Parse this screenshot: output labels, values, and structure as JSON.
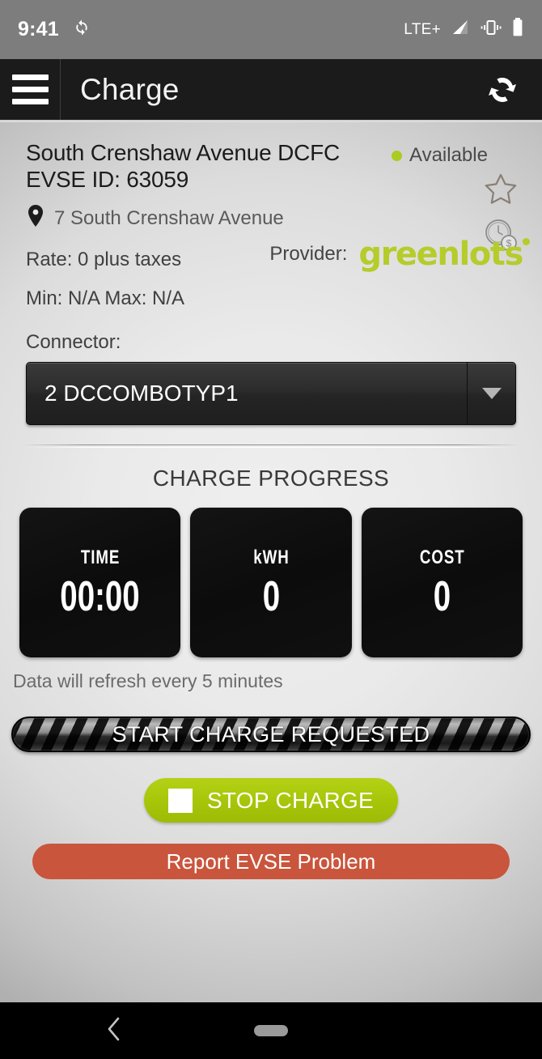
{
  "statusbar": {
    "time": "9:41",
    "sync_icon": "sync-icon",
    "network_label": "LTE+",
    "signal_icon": "signal-bars-icon",
    "vibrate_icon": "vibrate-icon",
    "battery_icon": "battery-icon"
  },
  "appbar": {
    "menu_icon": "hamburger-menu-icon",
    "title": "Charge",
    "refresh_icon": "refresh-sync-icon"
  },
  "station": {
    "title": "South Crenshaw Avenue DCFC EVSE ID: 63059",
    "status_label": "Available",
    "status_color": "#aacc22",
    "address": "7 South Crenshaw Avenue",
    "address_icon": "location-pin-icon",
    "rate_line": "Rate: 0 plus taxes",
    "minmax_line": "Min: N/A Max: N/A",
    "favorite_icon": "star-outline-icon",
    "pricing_icon": "clock-dollar-icon",
    "provider_label": "Provider:",
    "provider_name": "greenlots",
    "provider_color": "#b5cc2a"
  },
  "connector": {
    "label": "Connector:",
    "selected": "2 DCCOMBOTYP1",
    "dropdown_icon": "chevron-down-icon"
  },
  "progress": {
    "section_title": "CHARGE PROGRESS",
    "tiles": [
      {
        "label": "TIME",
        "value": "00:00",
        "name": "time"
      },
      {
        "label": "kWH",
        "value": "0",
        "name": "kwh"
      },
      {
        "label": "COST",
        "value": "0",
        "name": "cost"
      }
    ],
    "refresh_note": "Data will refresh every 5 minutes",
    "status_bar_label": "START CHARGE REQUESTED"
  },
  "actions": {
    "stop_charge_label": "STOP CHARGE",
    "stop_icon": "stop-square-icon",
    "stop_color": "#a7c609",
    "report_label": "Report EVSE Problem",
    "report_color": "#c9553c"
  },
  "navbar": {
    "back_icon": "back-chevron-icon",
    "home_pill_icon": "home-pill-icon"
  }
}
